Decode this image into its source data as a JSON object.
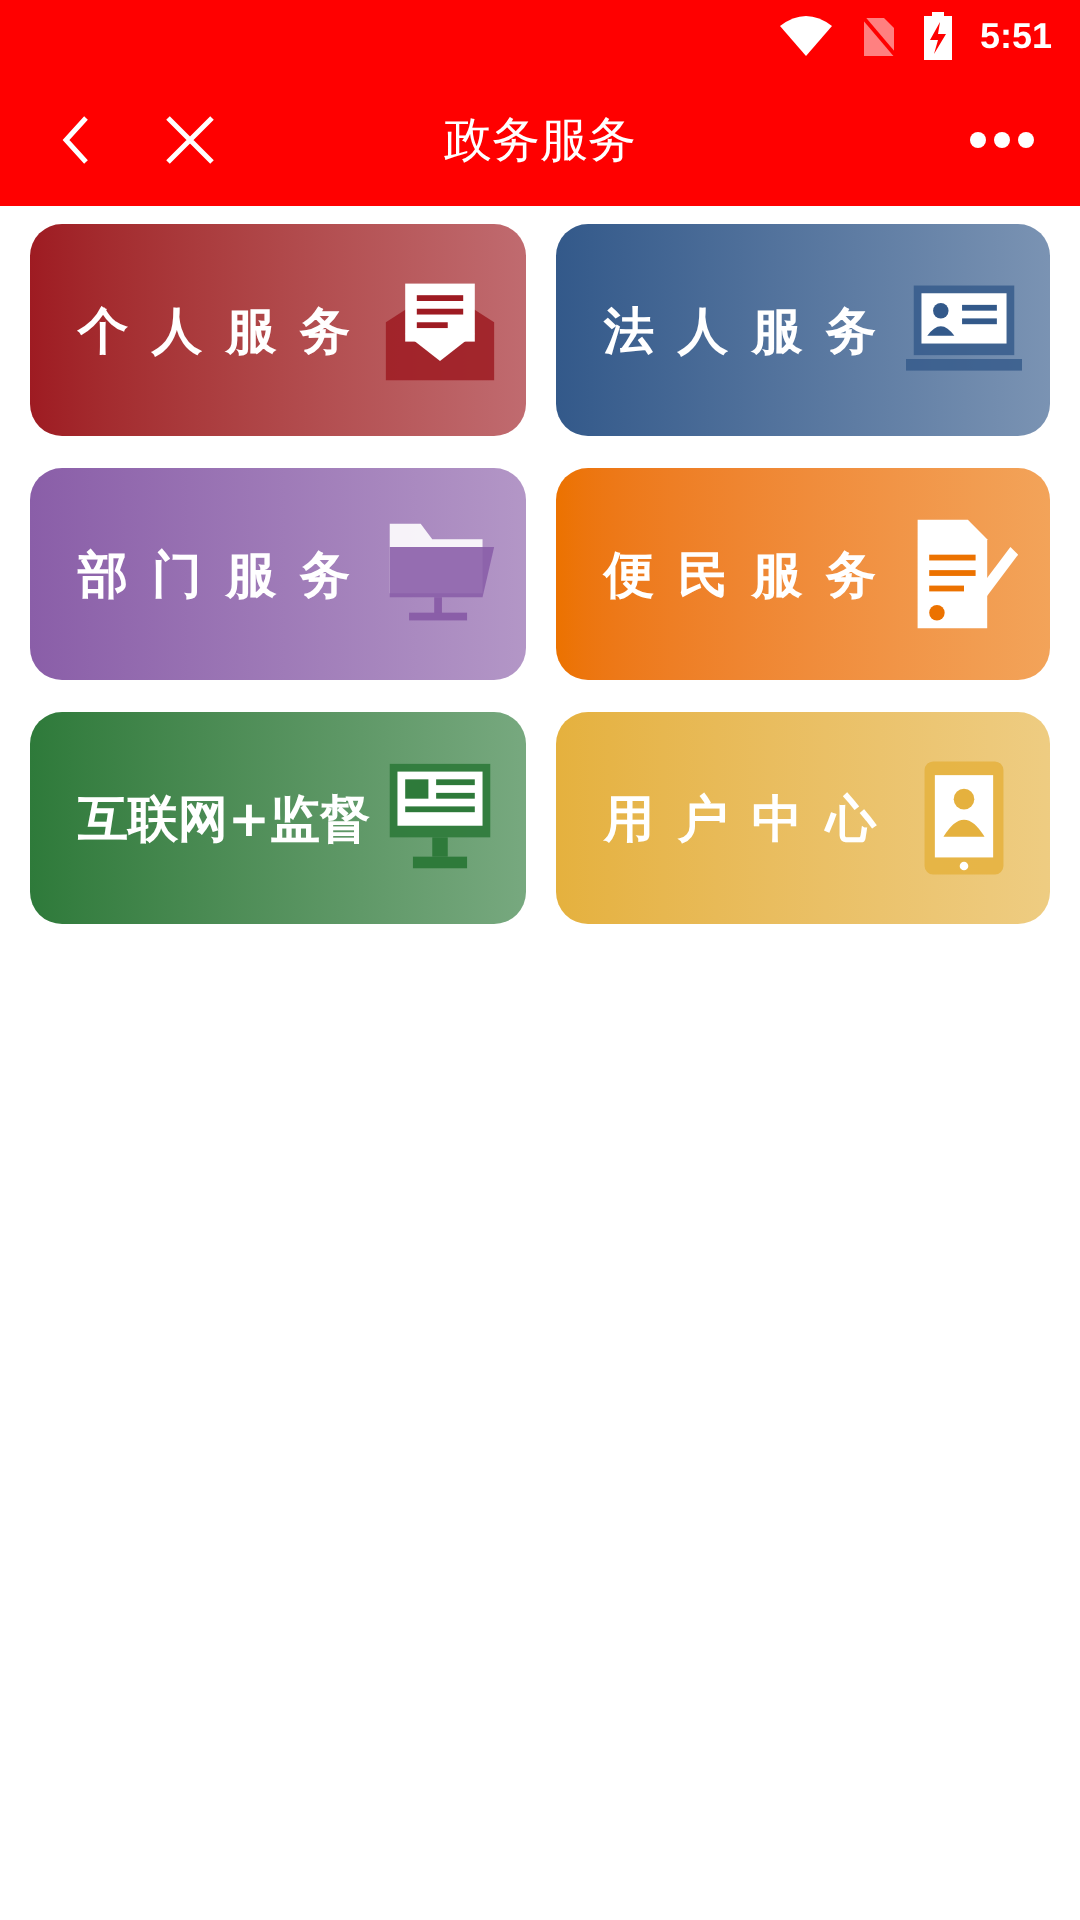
{
  "status_bar": {
    "time": "5:51"
  },
  "header": {
    "title": "政务服务"
  },
  "tiles": [
    {
      "label": "个人服务",
      "kind": "mail",
      "color": "#9e1b22"
    },
    {
      "label": "法人服务",
      "kind": "idcard",
      "color": "#33598a"
    },
    {
      "label": "部门服务",
      "kind": "folder",
      "color": "#8a5ea8"
    },
    {
      "label": "便民服务",
      "kind": "document",
      "color": "#ec7200"
    },
    {
      "label": "互联网+监督",
      "kind": "monitor",
      "color": "#2e7a3a"
    },
    {
      "label": "用户中心",
      "kind": "phone",
      "color": "#e5b13e"
    }
  ]
}
